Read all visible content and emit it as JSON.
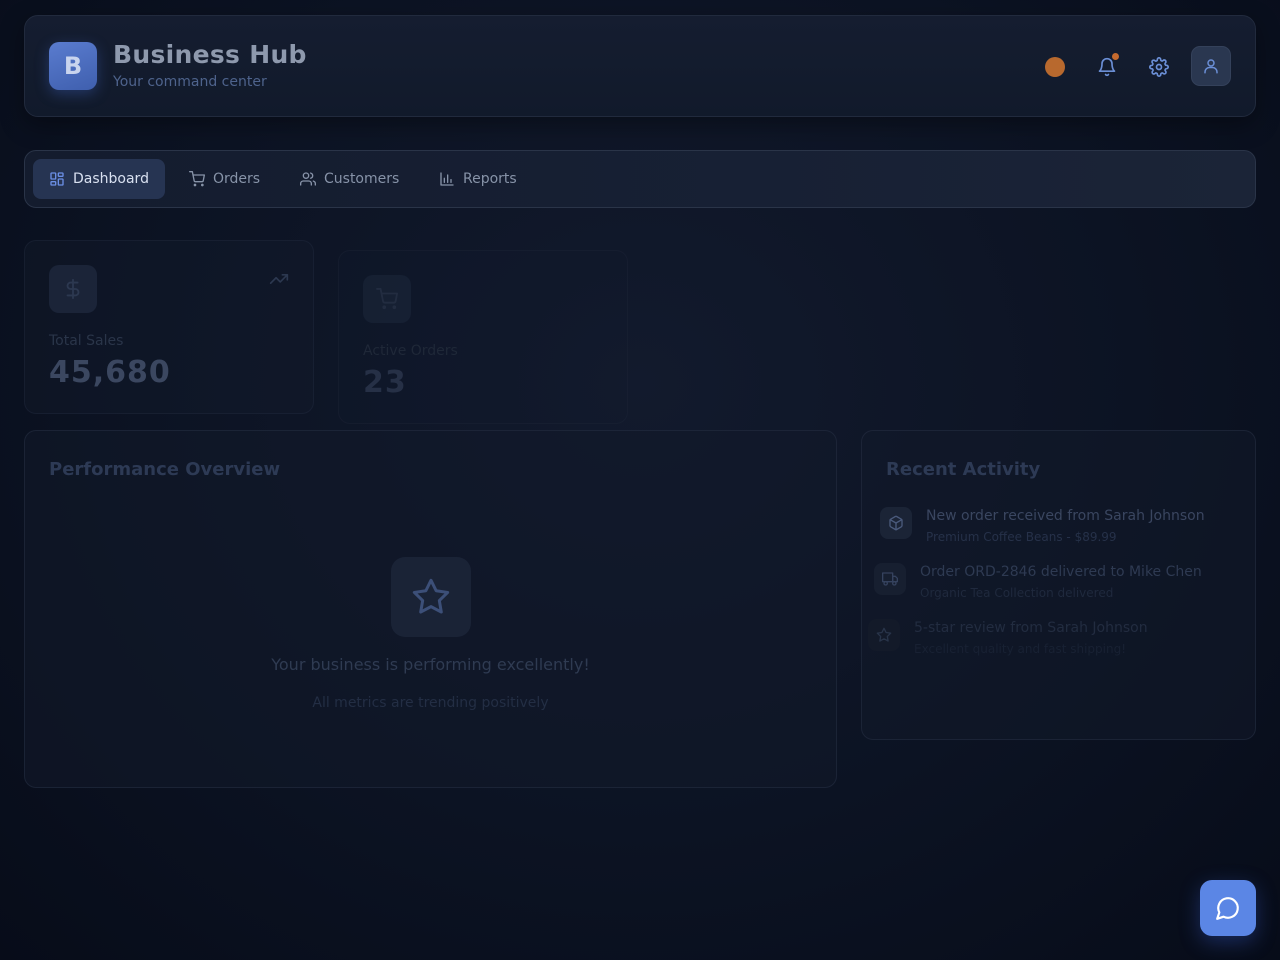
{
  "header": {
    "logo_letter": "B",
    "title": "Business Hub",
    "subtitle": "Your command center",
    "status_color": "#b8692e",
    "icons": [
      "bell-icon",
      "gear-icon",
      "user-icon"
    ]
  },
  "nav": {
    "items": [
      {
        "label": "Dashboard",
        "icon": "grid-icon",
        "active": true
      },
      {
        "label": "Orders",
        "icon": "cart-icon",
        "active": false
      },
      {
        "label": "Customers",
        "icon": "users-icon",
        "active": false
      },
      {
        "label": "Reports",
        "icon": "bar-chart-icon",
        "active": false
      }
    ]
  },
  "stats": [
    {
      "label": "Total Sales",
      "value": "45,680",
      "icon": "dollar-icon",
      "trend_icon": "trend-up-icon"
    },
    {
      "label": "Active Orders",
      "value": "23",
      "icon": "cart-icon"
    }
  ],
  "performance": {
    "title": "Performance Overview",
    "icon": "star-icon",
    "message": "Your business is performing excellently!",
    "submessage": "All metrics are trending positively"
  },
  "activity": {
    "title": "Recent Activity",
    "items": [
      {
        "icon": "package-icon",
        "title": "New order received from Sarah Johnson",
        "desc": "Premium Coffee Beans - $89.99"
      },
      {
        "icon": "truck-icon",
        "title": "Order ORD-2846 delivered to Mike Chen",
        "desc": "Organic Tea Collection delivered"
      },
      {
        "icon": "star-icon",
        "title": "5-star review from Sarah Johnson",
        "desc": "Excellent quality and fast shipping!"
      }
    ]
  },
  "colors": {
    "accent": "#5b86e5",
    "nav_active_bg": "#263452",
    "badge": "#c66a2e"
  },
  "chat": {
    "icon": "chat-bubble-icon"
  }
}
